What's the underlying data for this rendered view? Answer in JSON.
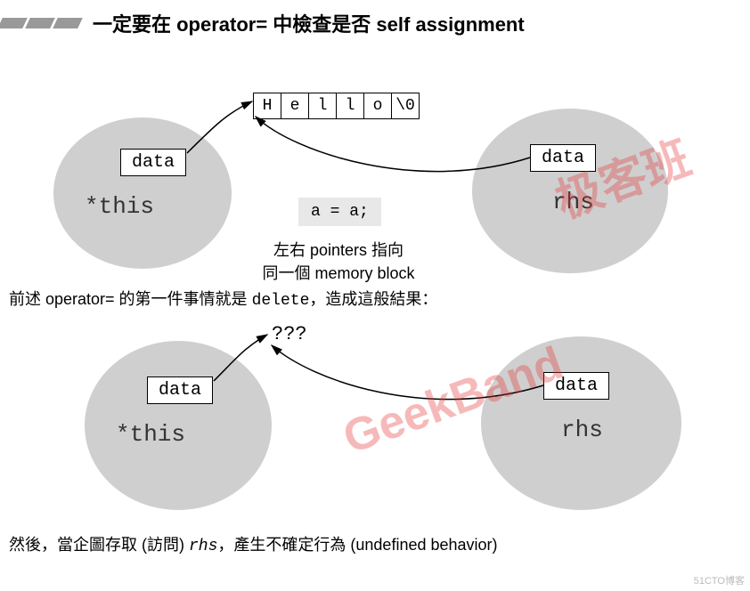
{
  "header": {
    "title": "一定要在 operator= 中檢查是否 self assignment"
  },
  "diagram1": {
    "left_data": "data",
    "right_data": "data",
    "left_label": "*this",
    "right_label": "rhs",
    "cells": [
      "H",
      "e",
      "l",
      "l",
      "o",
      "\\0"
    ],
    "code": "a = a;",
    "caption_line1": "左右 pointers 指向",
    "caption_line2": "同一個 memory block"
  },
  "text1": {
    "prefix": "前述 operator= 的第一件事情就是 ",
    "mono": "delete",
    "suffix": "，造成這般結果："
  },
  "diagram2": {
    "left_data": "data",
    "right_data": "data",
    "left_label": "*this",
    "right_label": "rhs",
    "question": "???"
  },
  "text2": {
    "p1": "然後，當企圖存取 (訪問) ",
    "rhs": "rhs",
    "p2": "，產生不確定行為 (undefined behavior)"
  },
  "watermark": {
    "w1": "GeekBand",
    "w2": "极客班"
  },
  "footer": "51CTO博客"
}
